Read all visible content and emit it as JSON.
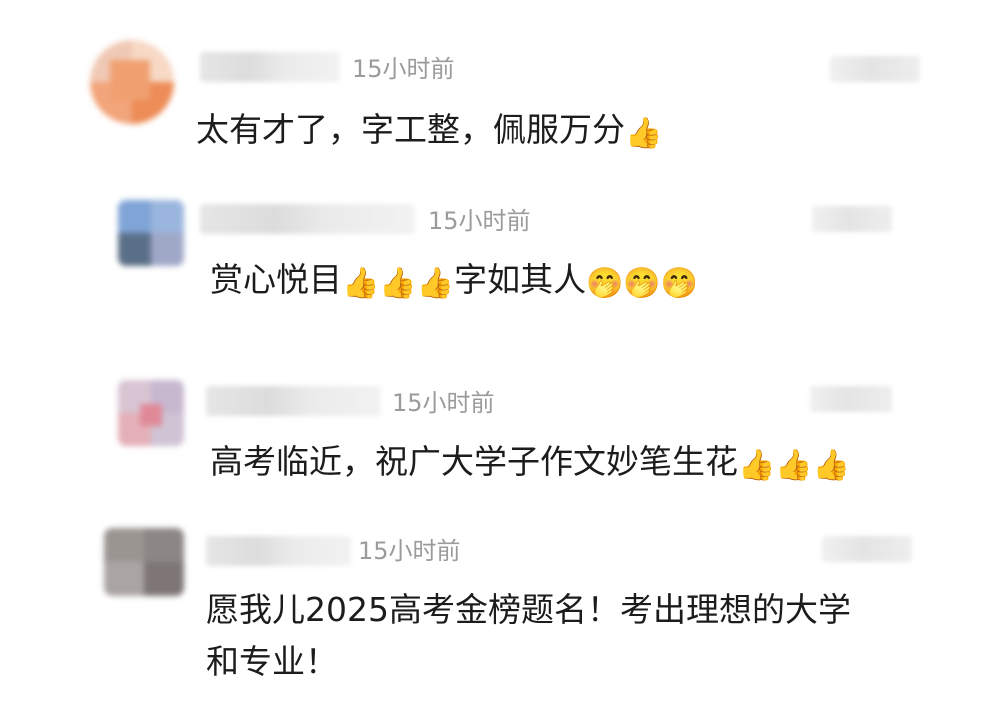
{
  "comments": [
    {
      "time": "15小时前",
      "text": "太有才了，字工整，佩服万分",
      "emojis": "👍",
      "text_after": ""
    },
    {
      "time": "15小时前",
      "text": "赏心悦目",
      "emojis": "👍👍👍",
      "text_after": "字如其人",
      "emojis_after": "🤭🤭🤭"
    },
    {
      "time": "15小时前",
      "text": "高考临近，祝广大学子作文妙笔生花",
      "emojis": "👍👍👍"
    },
    {
      "time": "15小时前",
      "text_line1": "愿我儿2025高考金榜题名！考出理想的大学",
      "text_line2": "和专业！"
    }
  ],
  "icons": {
    "thumbs_up": "thumbs-up-icon",
    "shy_face": "shy-face-icon"
  },
  "colors": {
    "time_text": "#9b9b9b",
    "body_text": "#1c1c1c",
    "background": "#ffffff"
  }
}
